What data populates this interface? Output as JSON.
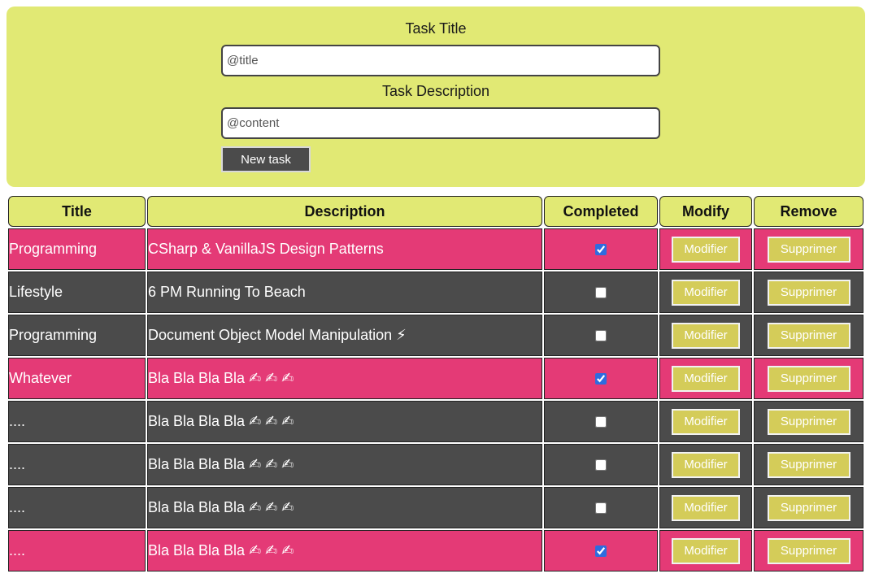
{
  "form": {
    "title_label": "Task Title",
    "title_placeholder": "@title",
    "description_label": "Task Description",
    "description_placeholder": "@content",
    "new_task_button": "New task"
  },
  "table": {
    "headers": {
      "title": "Title",
      "description": "Description",
      "completed": "Completed",
      "modify": "Modify",
      "remove": "Remove"
    },
    "modify_button_label": "Modifier",
    "remove_button_label": "Supprimer",
    "rows": [
      {
        "title": "Programming",
        "description": "CSharp & VanillaJS Design Patterns",
        "completed": true
      },
      {
        "title": "Lifestyle",
        "description": "6 PM Running To Beach",
        "completed": false
      },
      {
        "title": "Programming",
        "description": "Document Object Model Manipulation ⚡",
        "completed": false
      },
      {
        "title": "Whatever",
        "description": "Bla Bla Bla Bla ✍ ✍ ✍",
        "completed": true
      },
      {
        "title": "....",
        "description": "Bla Bla Bla Bla ✍ ✍ ✍",
        "completed": false
      },
      {
        "title": "....",
        "description": "Bla Bla Bla Bla ✍ ✍ ✍",
        "completed": false
      },
      {
        "title": "....",
        "description": "Bla Bla Bla Bla ✍ ✍ ✍",
        "completed": false
      },
      {
        "title": "....",
        "description": "Bla Bla Bla Bla ✍ ✍ ✍",
        "completed": true
      }
    ]
  },
  "colors": {
    "panel": "#e1e974",
    "completed_row": "#e43a76",
    "pending_row": "#4b4b4b",
    "action_button": "#d4cc59"
  }
}
